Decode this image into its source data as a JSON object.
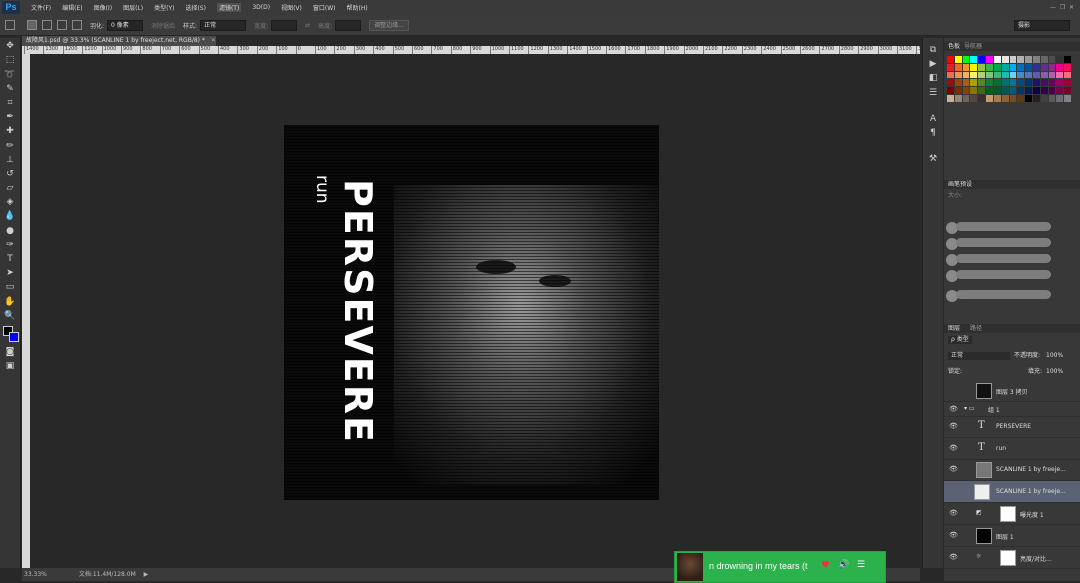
{
  "app": {
    "logo": "Ps"
  },
  "menu": [
    "文件(F)",
    "编辑(E)",
    "图像(I)",
    "图层(L)",
    "类型(Y)",
    "选择(S)",
    "滤镜(T)",
    "3D(D)",
    "视图(V)",
    "窗口(W)",
    "帮助(H)"
  ],
  "options": {
    "feather_label": "羽化:",
    "feather_value": "0 像素",
    "antialias_label": "消除锯齿",
    "style_label": "样式:",
    "style_value": "正常",
    "width_label": "宽度:",
    "height_label": "高度:",
    "refine_edge": "调整边缘...",
    "workspace": "摄影"
  },
  "document": {
    "tab_title": "故障风1.psd @ 33.3% (SCANLINE 1 by freeject.net, RGB/8) *",
    "zoom": "33.33%",
    "file_info": "文档:11.4M/128.0M"
  },
  "ruler_labels": [
    "1400",
    "1300",
    "1200",
    "1100",
    "1000",
    "900",
    "800",
    "700",
    "600",
    "500",
    "400",
    "300",
    "200",
    "100",
    "0",
    "100",
    "200",
    "300",
    "400",
    "500",
    "600",
    "700",
    "800",
    "900",
    "1000",
    "1100",
    "1200",
    "1300",
    "1400",
    "1500",
    "1600",
    "1700",
    "1800",
    "1900",
    "2000",
    "2100",
    "2200",
    "2300",
    "2400",
    "2500",
    "2600",
    "2700",
    "2800",
    "2900",
    "3000",
    "3100",
    "3200"
  ],
  "artwork": {
    "big_text": "PERSEVERE",
    "small_text": "run"
  },
  "panels": {
    "swatches_tab": "色板",
    "swatches_tab2": "导航器",
    "brush_tab": "画笔预设",
    "brush_size_label": "大小:",
    "layers_tab": "图层",
    "paths_tab": "路径",
    "kind_label": "ρ 类型",
    "blend_mode": "正常",
    "opacity_label": "不透明度:",
    "opacity_value": "100%",
    "lock_label": "锁定:",
    "fill_label": "填充:",
    "fill_value": "100%"
  },
  "layers": [
    {
      "name": "图层 3 拷贝",
      "kind": "pixel"
    },
    {
      "name": "组 1",
      "kind": "group"
    },
    {
      "name": "PERSEVERE",
      "kind": "text"
    },
    {
      "name": "run",
      "kind": "text"
    },
    {
      "name": "SCANLINE 1 by freeje...",
      "kind": "pixel"
    },
    {
      "name": "SCANLINE 1 by freeje...",
      "kind": "pixel",
      "selected": true
    },
    {
      "name": "曝光度 1",
      "kind": "adjustment"
    },
    {
      "name": "图层 1",
      "kind": "pixel"
    },
    {
      "name": "亮度/对比...",
      "kind": "adjustment"
    }
  ],
  "music": {
    "song": "n drowning in my tears (t"
  },
  "colors": {
    "accent_green": "#2bb24c",
    "selected_layer": "#5a6273",
    "foreground": "#000000",
    "background": "#0000ff"
  }
}
